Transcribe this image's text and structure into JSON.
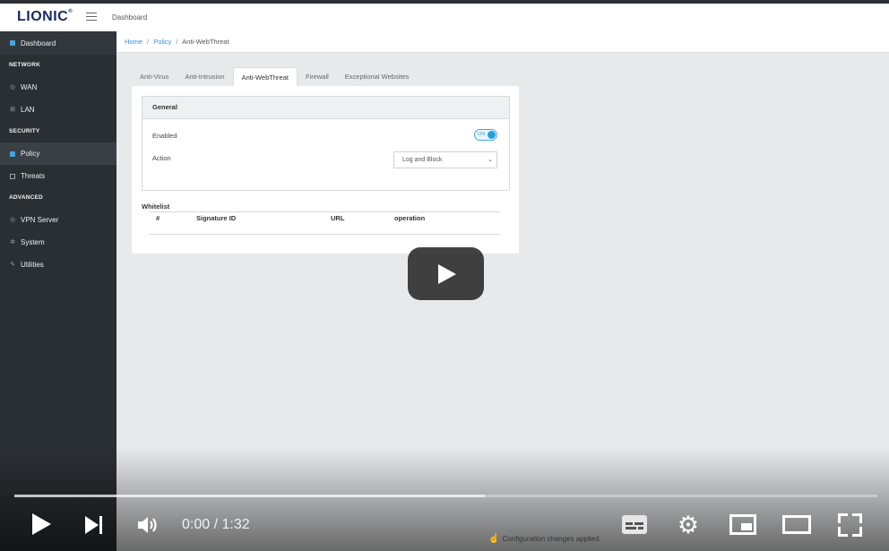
{
  "topbar": {
    "logo": "LIONIC",
    "logo_mark": "®",
    "title": "Dashboard"
  },
  "sidebar": {
    "dashboard": "Dashboard",
    "sections": [
      {
        "heading": "NETWORK",
        "items": [
          "WAN",
          "LAN"
        ]
      },
      {
        "heading": "SECURITY",
        "items": [
          "Policy",
          "Threats"
        ]
      },
      {
        "heading": "ADVANCED",
        "items": [
          "VPN Server",
          "System",
          "Utilities"
        ]
      }
    ],
    "active_item": "Policy"
  },
  "breadcrumb": {
    "home": "Home",
    "sep1": "/",
    "policy": "Policy",
    "sep2": "/",
    "current": "Anti-WebThreat"
  },
  "tabs": [
    "Anti-Virus",
    "Anti-Intrusion",
    "Anti-WebThreat",
    "Firewall",
    "Exceptional Websites"
  ],
  "active_tab": "Anti-WebThreat",
  "general": {
    "title": "General",
    "enabled_label": "Enabled",
    "toggle_text": "ON",
    "action_label": "Action",
    "action_value": "Log and Block",
    "select_arrow": "⌄"
  },
  "whitelist": {
    "title": "Whitelist",
    "columns": [
      "#",
      "Signature ID",
      "URL",
      "operation"
    ]
  },
  "video": {
    "time": "0:00 / 1:32",
    "played_fraction": 0.0,
    "loaded_fraction": 0.545,
    "gear_glyph": "⚙"
  },
  "toast": {
    "icon": "☝",
    "text": "Configuration changes applied."
  }
}
